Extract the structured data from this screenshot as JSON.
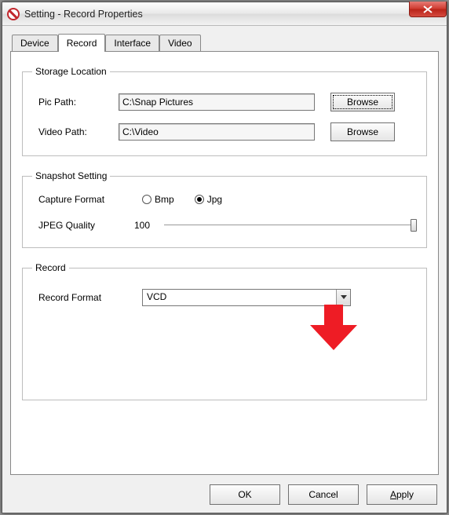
{
  "window": {
    "title": "Setting - Record Properties"
  },
  "tabs": {
    "device": "Device",
    "record": "Record",
    "interface": "Interface",
    "video": "Video"
  },
  "storage": {
    "legend": "Storage Location",
    "picPathLabel": "Pic Path:",
    "picPathValue": "C:\\Snap Pictures",
    "videoPathLabel": "Video Path:",
    "videoPathValue": "C:\\Video",
    "browse1": "Browse",
    "browse2": "Browse"
  },
  "snapshot": {
    "legend": "Snapshot Setting",
    "captureFormatLabel": "Capture Format",
    "bmp": "Bmp",
    "jpg": "Jpg",
    "jpegQualityLabel": "JPEG Quality",
    "jpegQualityValue": "100"
  },
  "record": {
    "legend": "Record",
    "recordFormatLabel": "Record Format",
    "recordFormatValue": "VCD"
  },
  "buttons": {
    "ok": "OK",
    "cancel": "Cancel",
    "apply": "Apply"
  }
}
